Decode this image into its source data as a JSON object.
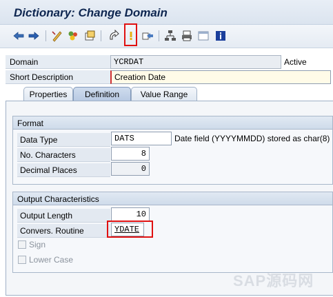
{
  "window": {
    "title": "Dictionary: Change Domain"
  },
  "toolbar": {
    "icons": [
      "back-icon",
      "forward-icon",
      "display-change-icon",
      "other-object-icon",
      "check-icon",
      "activate-icon",
      "where-used-icon",
      "navigate-icon",
      "hierarchy-icon",
      "print-icon",
      "display-object-list-icon",
      "info-icon"
    ]
  },
  "header": {
    "domain_label": "Domain",
    "domain_value": "YCRDAT",
    "status": "Active",
    "short_desc_label": "Short Description",
    "short_desc_value": "Creation Date"
  },
  "tabs": [
    {
      "label": "Properties",
      "active": false
    },
    {
      "label": "Definition",
      "active": true
    },
    {
      "label": "Value Range",
      "active": false
    }
  ],
  "format": {
    "title": "Format",
    "data_type_label": "Data Type",
    "data_type_value": "DATS",
    "data_type_desc": "Date field (YYYYMMDD) stored as char(8)",
    "no_chars_label": "No. Characters",
    "no_chars_value": "8",
    "decimals_label": "Decimal Places",
    "decimals_value": "0"
  },
  "output": {
    "title": "Output Characteristics",
    "output_length_label": "Output Length",
    "output_length_value": "10",
    "convers_label": "Convers. Routine",
    "convers_value": "YDATE",
    "sign_label": "Sign",
    "lower_case_label": "Lower Case"
  },
  "watermark": "SAP源码网"
}
